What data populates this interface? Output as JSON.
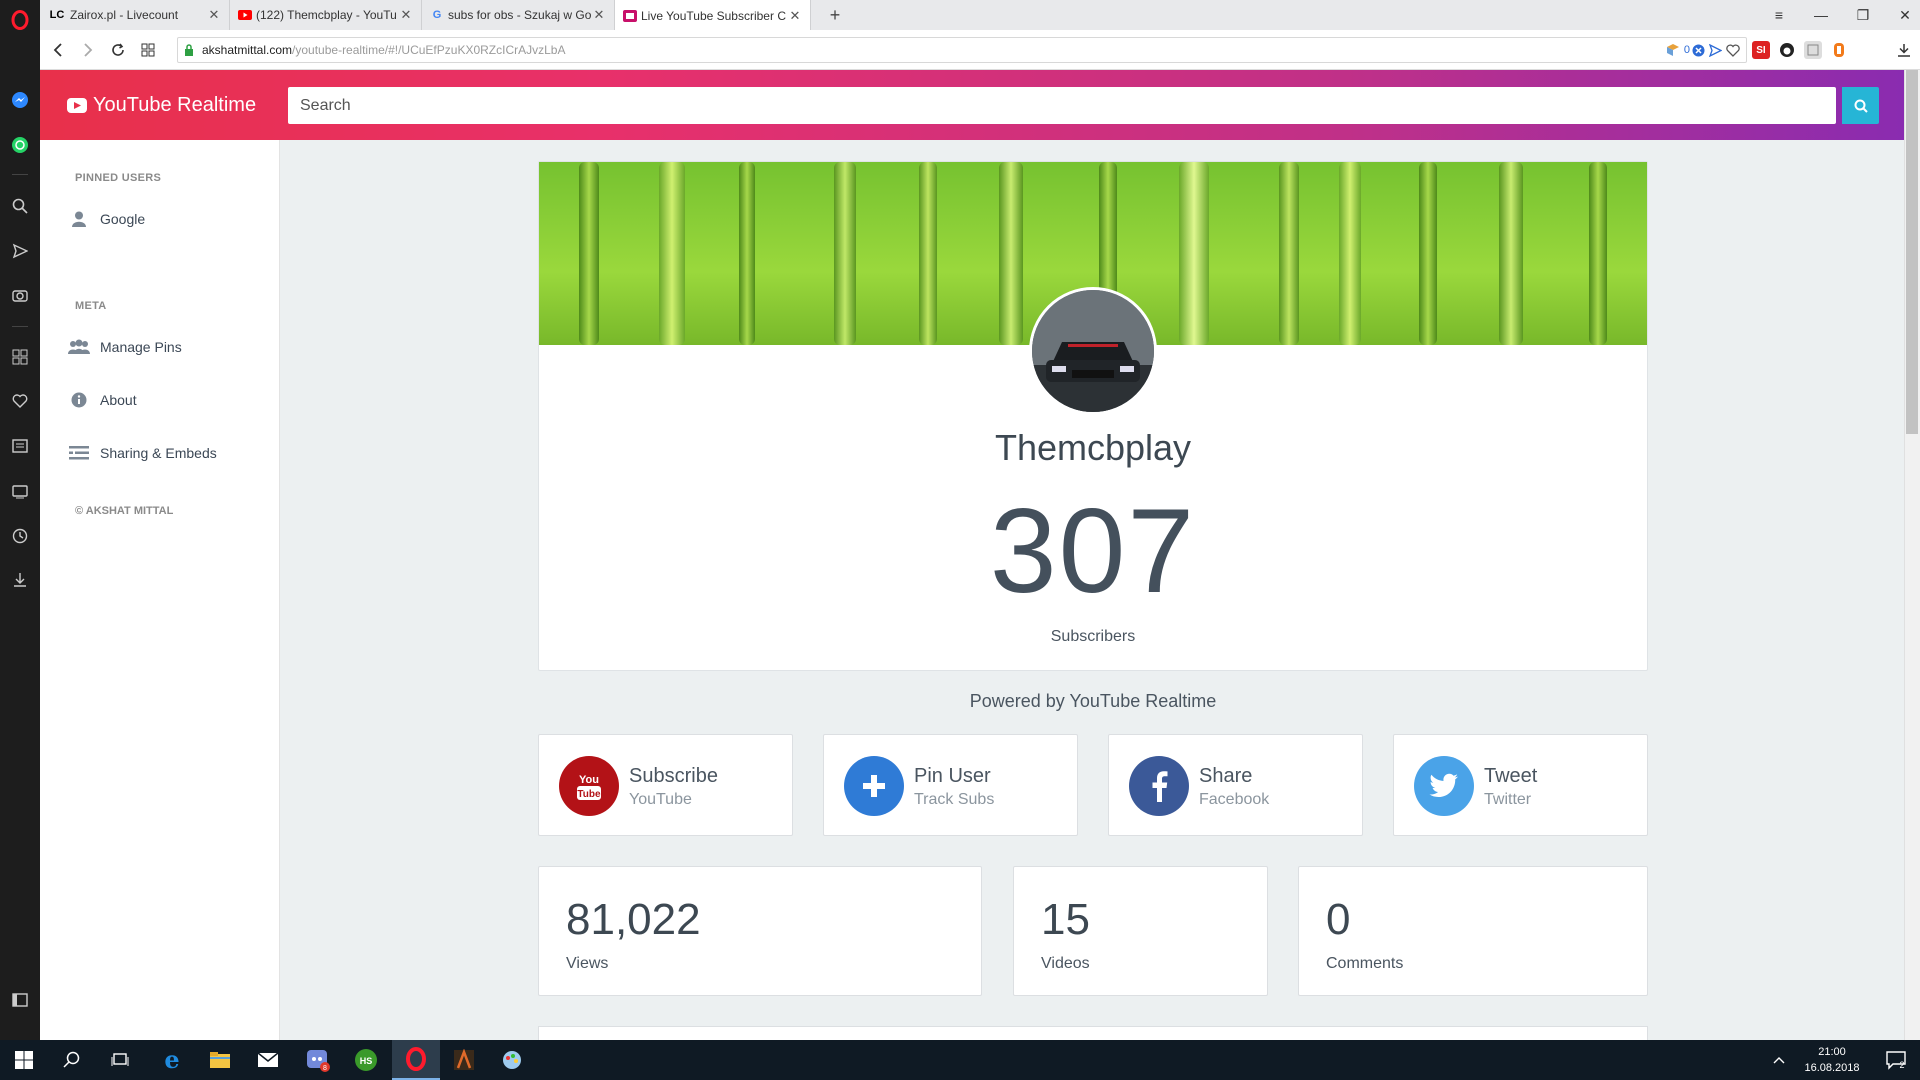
{
  "browser": {
    "tabs": [
      {
        "favicon": "LC",
        "title": "Zairox.pl - Livecount"
      },
      {
        "favicon": "youtube-icon",
        "title": "(122) Themcbplay - YouTu"
      },
      {
        "favicon": "google-icon",
        "title": "subs for obs - Szukaj w Go"
      },
      {
        "favicon": "youtube-realtime-icon",
        "title": "Live YouTube Subscriber C"
      }
    ],
    "url_host": "akshatmittal.com",
    "url_path": "/youtube-realtime/#!/UCuEfPzuKX0RZcICrAJvzLbA",
    "badge_count": "0"
  },
  "app": {
    "brand": "YouTube Realtime",
    "search_placeholder": "Search",
    "accent_color": "#26b5d6",
    "header_gradient": [
      "#e8304a",
      "#8a2cb0"
    ]
  },
  "sidebar": {
    "pinned_heading": "PINNED USERS",
    "pinned_users": [
      {
        "label": "Google"
      }
    ],
    "meta_heading": "META",
    "meta_items": [
      {
        "label": "Manage Pins",
        "icon": "users-icon"
      },
      {
        "label": "About",
        "icon": "info-icon"
      },
      {
        "label": "Sharing & Embeds",
        "icon": "list-icon"
      }
    ],
    "copyright": "© AKSHAT MITTAL"
  },
  "channel": {
    "name": "Themcbplay",
    "subscribers": "307",
    "subscribers_label": "Subscribers"
  },
  "powered_by": "Powered by YouTube Realtime",
  "actions": [
    {
      "title": "Subscribe",
      "subtitle": "YouTube",
      "icon": "youtube-icon",
      "color": "#b31217"
    },
    {
      "title": "Pin User",
      "subtitle": "Track Subs",
      "icon": "plus-icon",
      "color": "#2f7bd6"
    },
    {
      "title": "Share",
      "subtitle": "Facebook",
      "icon": "facebook-icon",
      "color": "#3b5998"
    },
    {
      "title": "Tweet",
      "subtitle": "Twitter",
      "icon": "twitter-icon",
      "color": "#4aa3e8"
    }
  ],
  "stats": [
    {
      "value": "81,022",
      "label": "Views"
    },
    {
      "value": "15",
      "label": "Videos"
    },
    {
      "value": "0",
      "label": "Comments"
    }
  ],
  "taskbar": {
    "time": "21:00",
    "date": "16.08.2018",
    "notification_count": "2"
  }
}
